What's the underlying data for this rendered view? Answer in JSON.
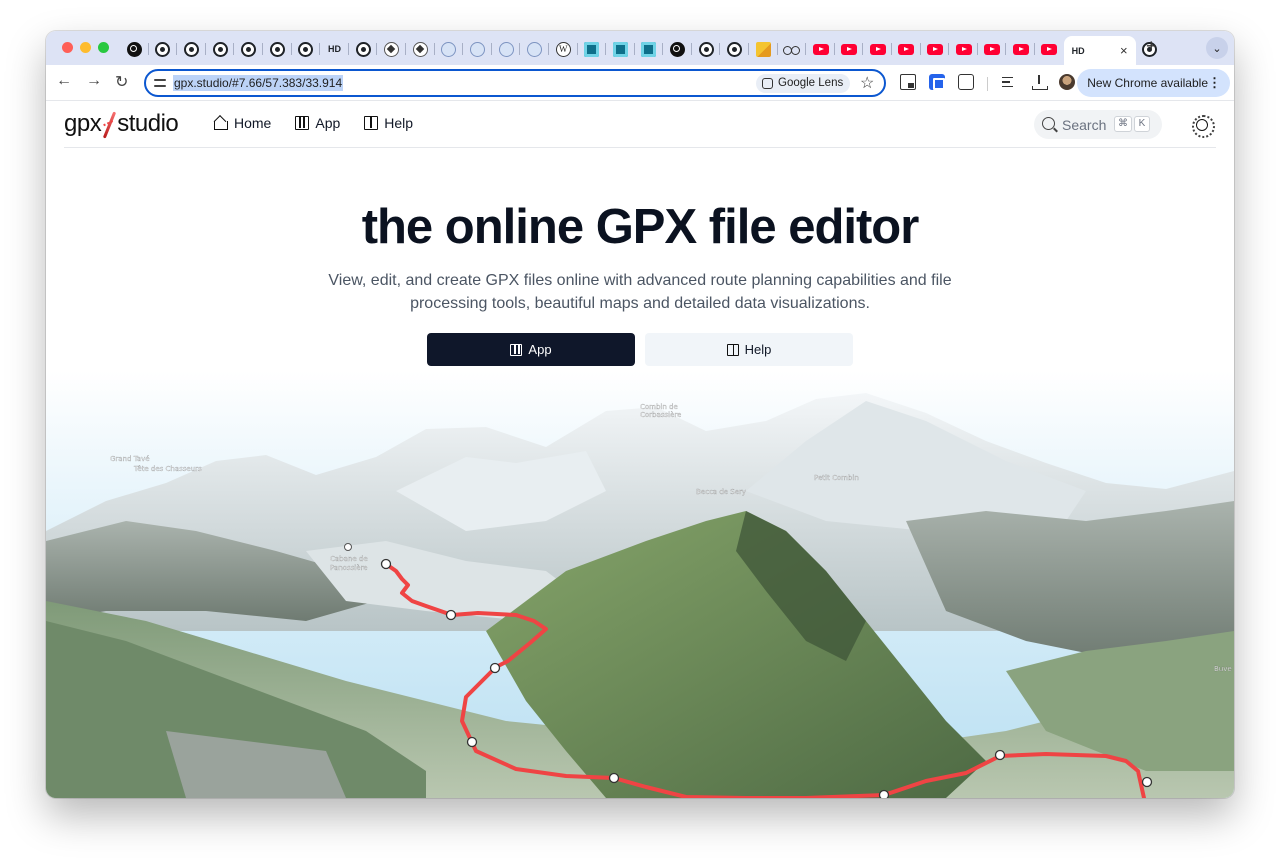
{
  "browser": {
    "tabs": {
      "favicons": [
        "openai-icon",
        "github-icon",
        "github-icon",
        "github-icon",
        "github-icon",
        "github-icon",
        "github-icon",
        "hd-icon",
        "github-icon",
        "circle-diamond-icon",
        "circle-diamond-icon",
        "image-icon",
        "image-icon",
        "image-icon",
        "image-icon",
        "wikipedia-icon",
        "box-icon",
        "box-icon",
        "box-icon",
        "dark-circle-icon",
        "github-icon",
        "github-icon",
        "pencil-icon",
        "bike-icon",
        "youtube-icon",
        "youtube-icon",
        "youtube-icon",
        "youtube-icon",
        "youtube-icon",
        "youtube-icon",
        "youtube-icon",
        "youtube-icon",
        "youtube-icon"
      ],
      "hd_label": "HD",
      "active_label": "HD",
      "close_symbol": "×",
      "new_tab_symbol": "+",
      "tab_search_symbol": "⌄"
    },
    "toolbar": {
      "back_symbol": "←",
      "forward_symbol": "→",
      "reload_symbol": "↻",
      "url": "gpx.studio/#7.66/57.383/33.914",
      "lens_label": "Google Lens",
      "bookmark_symbol": "☆",
      "update_label": "New Chrome available",
      "update_menu_symbol": "⋮"
    }
  },
  "site": {
    "logo_left": "gpx",
    "logo_right": "studio",
    "nav": {
      "home": "Home",
      "app": "App",
      "help": "Help"
    },
    "search": {
      "placeholder": "Search",
      "kbd_cmd": "⌘",
      "kbd_key": "K"
    }
  },
  "hero": {
    "title": "the online GPX file editor",
    "subtitle": "View, edit, and create GPX files online with advanced route planning capabilities and file processing tools, beautiful maps and detailed data visualizations.",
    "app_button": "App",
    "help_button": "Help"
  },
  "map": {
    "labels": {
      "grand_tave": "Grand Tavé",
      "tete_chasseurs": "Tête des Chasseurs",
      "cabane": "Cabane de",
      "panossiere": "Panossière",
      "becca": "Becca de Sery",
      "petit_combin": "Petit Combin",
      "buve": "Buve",
      "combin_corbassiere": "Combin de",
      "corbassiere": "Corbassière"
    },
    "route_color": "#ef4444"
  }
}
